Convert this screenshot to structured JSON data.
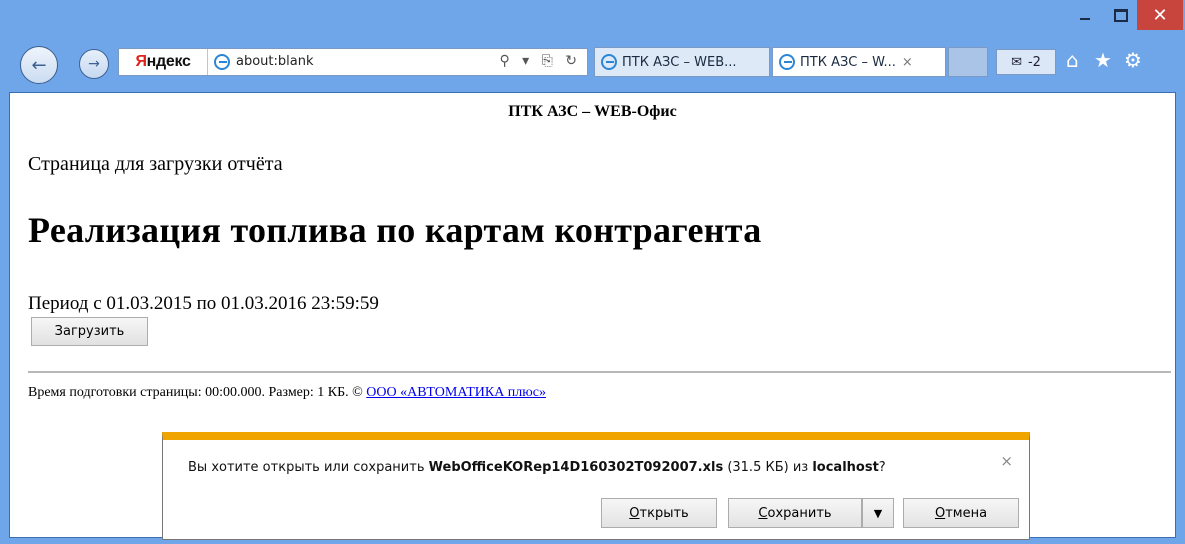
{
  "window": {
    "minimize": "",
    "maximize": "",
    "close": "✕"
  },
  "nav": {
    "back": "←",
    "forward": "→",
    "search_provider_part1": "Я",
    "search_provider_part2": "ндекс",
    "address": "about:blank",
    "address_tools": "⚲ ▾ ⎘ ↻"
  },
  "tabs": [
    {
      "label": "ПТК АЗС – WEB..."
    },
    {
      "label": "ПТК АЗС – W...",
      "close": "×"
    }
  ],
  "toolbar": {
    "mail_count": "-2",
    "home": "⌂",
    "favorites": "★",
    "settings": "⚙"
  },
  "page": {
    "site_title": "ПТК АЗС – WEB-Офис",
    "subtitle": "Страница для загрузки отчёта",
    "report_title": "Реализация топлива по картам контрагента",
    "period": "Период с 01.03.2015 по 01.03.2016 23:59:59",
    "load_button": "Загрузить",
    "footer_text": "Время подготовки страницы: 00:00.000. Размер: 1 КБ. © ",
    "footer_link": "ООО «АВТОМАТИКА плюс»"
  },
  "download": {
    "msg_prefix": "Вы хотите открыть или сохранить ",
    "filename": "WebOfficeKORep14D160302T092007.xls",
    "size": " (31.5 КБ) из ",
    "host": "localhost",
    "suffix": "?",
    "close": "×",
    "open_first": "О",
    "open_rest": "ткрыть",
    "save_first": "С",
    "save_rest": "охранить",
    "save_arrow": "▼",
    "cancel_first": "О",
    "cancel_rest": "тмена"
  }
}
